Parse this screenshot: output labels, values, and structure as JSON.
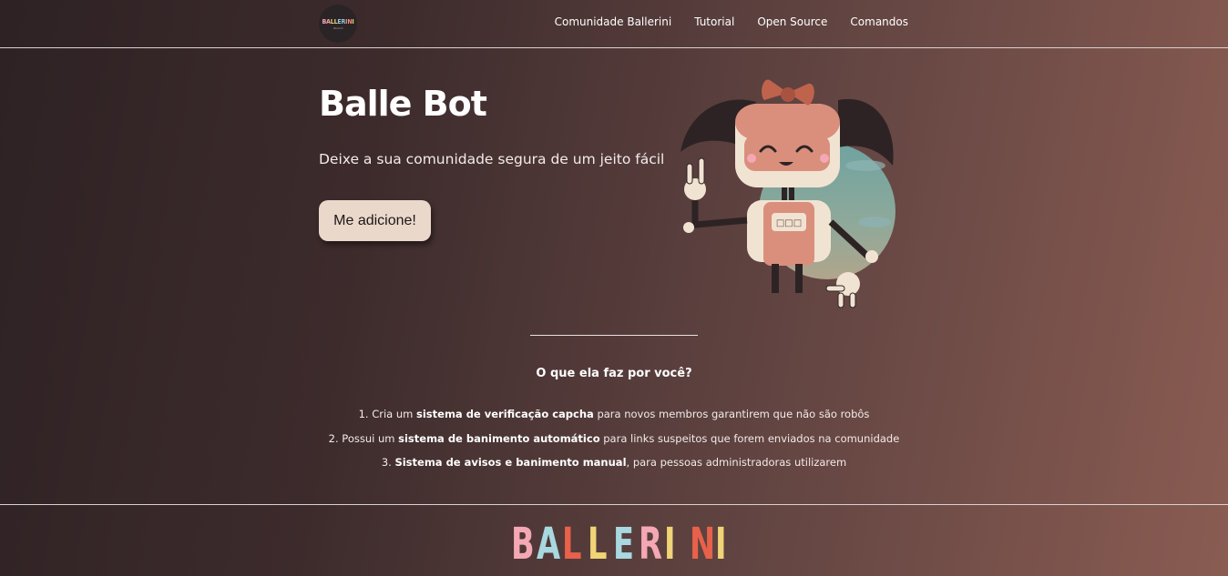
{
  "header": {
    "logo": {
      "letters": [
        {
          "char": "B",
          "color": "#f3a6b3"
        },
        {
          "char": "A",
          "color": "#f3a6b3"
        },
        {
          "char": "L",
          "color": "#e9d27a"
        },
        {
          "char": "L",
          "color": "#e9d27a"
        },
        {
          "char": "E",
          "color": "#8fc7d9"
        },
        {
          "char": "R",
          "color": "#8fc7d9"
        },
        {
          "char": "I",
          "color": "#f09080"
        },
        {
          "char": "N",
          "color": "#f09080"
        },
        {
          "char": "I",
          "color": "#e9d27a"
        }
      ],
      "caption": "discord"
    },
    "nav": [
      {
        "label": "Comunidade Ballerini"
      },
      {
        "label": "Tutorial"
      },
      {
        "label": "Open Source"
      },
      {
        "label": "Comandos"
      }
    ]
  },
  "hero": {
    "title": "Balle Bot",
    "subtitle": "Deixe a sua comunidade segura de um jeito fácil",
    "cta_label": "Me adicione!",
    "robot_screen_text": "□□□"
  },
  "features": {
    "title": "O que ela faz por você?",
    "items": [
      {
        "prefix": "1. Cria um ",
        "bold": "sistema de verificação capcha",
        "suffix": " para novos membros garantirem que não são robôs"
      },
      {
        "prefix": "2. Possui um ",
        "bold": "sistema de banimento automático",
        "suffix": " para links suspeitos que forem enviados na comunidade"
      },
      {
        "prefix": "3. ",
        "bold": "Sistema de avisos e banimento manual",
        "suffix": ", para pessoas administradoras utilizarem"
      }
    ]
  },
  "footer": {
    "logo_letters": [
      {
        "char": "B",
        "color": "#f4a7b4"
      },
      {
        "char": "A",
        "color": "#a8d8e0"
      },
      {
        "char": "L",
        "color": "#e8614a"
      },
      {
        "char": "L",
        "color": "#f0d476"
      },
      {
        "char": "E",
        "color": "#a8d8e0"
      },
      {
        "char": "R",
        "color": "#f4a7b4"
      },
      {
        "char": "I",
        "color": "#f0d476"
      },
      {
        "char": "N",
        "color": "#e8614a"
      },
      {
        "char": "I",
        "color": "#f0d476"
      }
    ]
  },
  "colors": {
    "button_bg": "#ead8cb",
    "divider": "#e8e2e0"
  }
}
